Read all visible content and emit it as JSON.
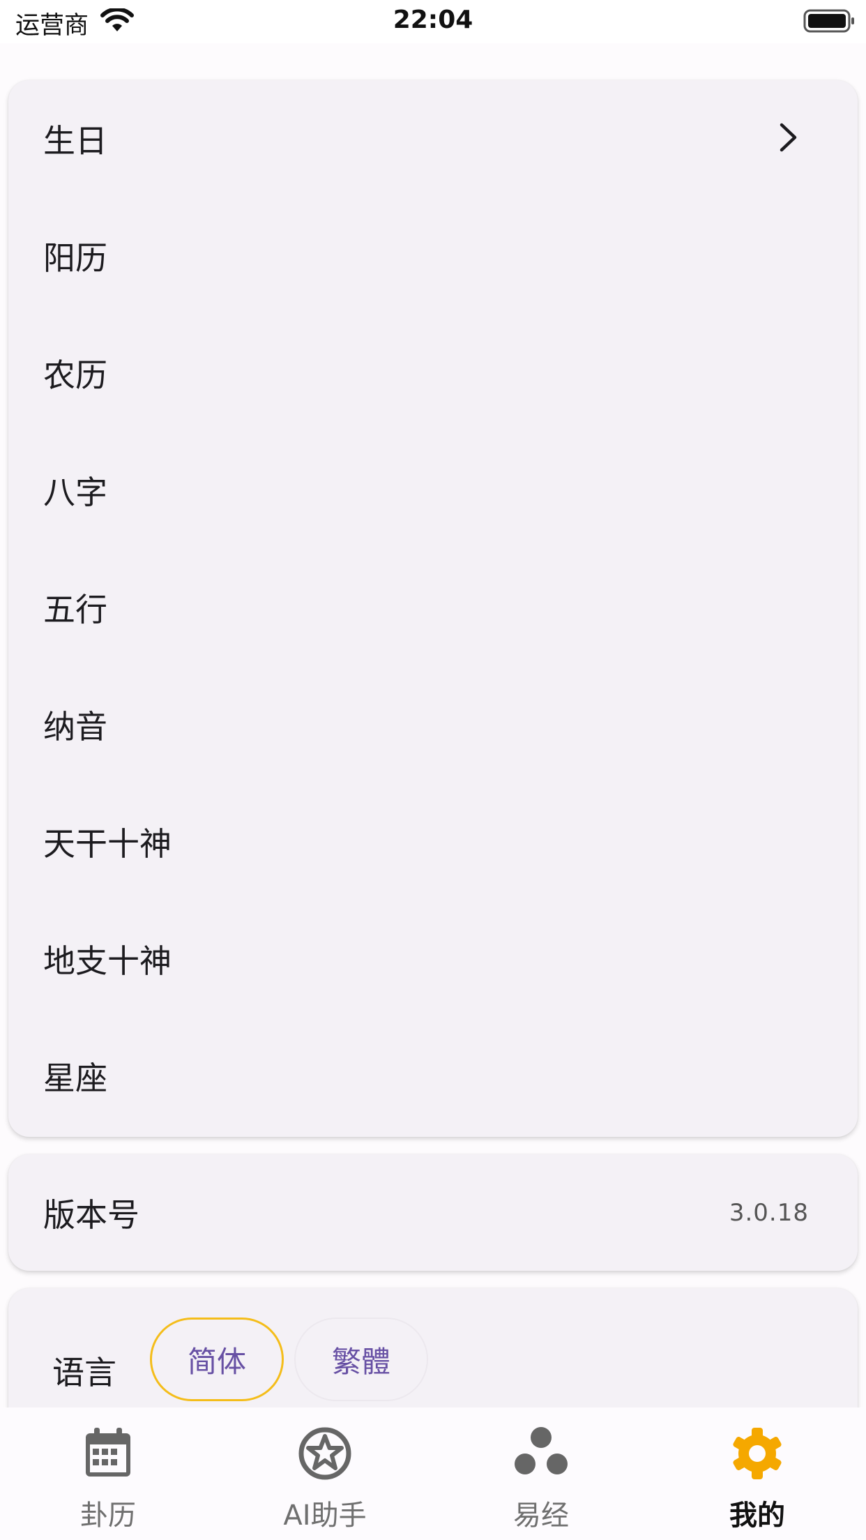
{
  "status_bar": {
    "carrier": "运营商",
    "time": "22:04"
  },
  "profile_list": {
    "items": [
      {
        "label": "生日"
      },
      {
        "label": "阳历"
      },
      {
        "label": "农历"
      },
      {
        "label": "八字"
      },
      {
        "label": "五行"
      },
      {
        "label": "纳音"
      },
      {
        "label": "天干十神"
      },
      {
        "label": "地支十神"
      },
      {
        "label": "星座"
      }
    ]
  },
  "version": {
    "label": "版本号",
    "value": "3.0.18"
  },
  "language": {
    "label": "语言",
    "options": [
      "简体",
      "繁體"
    ],
    "selected": "简体"
  },
  "bottom_nav": {
    "items": [
      {
        "label": "卦历",
        "icon": "calendar-icon"
      },
      {
        "label": "AI助手",
        "icon": "star-circle-icon"
      },
      {
        "label": "易经",
        "icon": "three-dots-icon"
      },
      {
        "label": "我的",
        "icon": "gear-icon"
      }
    ],
    "active": "我的"
  },
  "colors": {
    "accent": "#f4bd1a",
    "chip_text": "#6750a4",
    "card_bg": "#f4f1f6"
  }
}
